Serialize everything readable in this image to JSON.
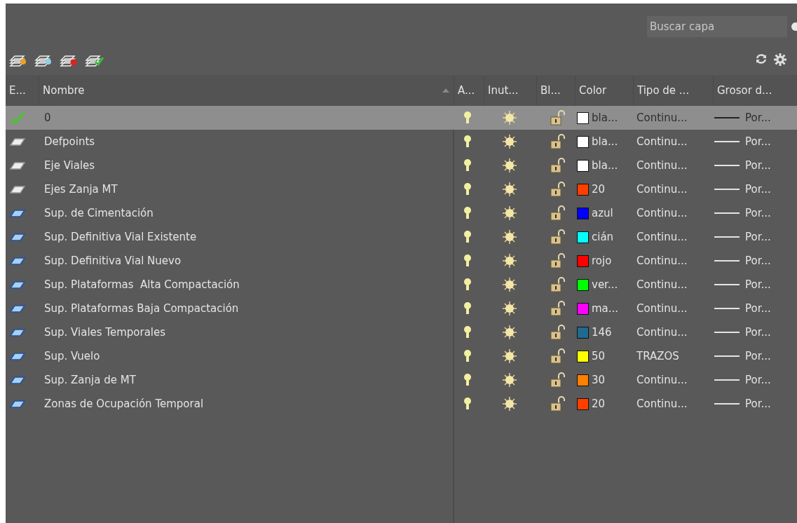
{
  "search": {
    "placeholder": "Buscar capa"
  },
  "table": {
    "columns": [
      {
        "label": "E...",
        "sorted": false
      },
      {
        "label": "Nombre",
        "sorted": true
      },
      {
        "label": "A...",
        "sorted": false
      },
      {
        "label": "Inut...",
        "sorted": false
      },
      {
        "label": "Bl...",
        "sorted": false
      },
      {
        "label": "Color",
        "sorted": false
      },
      {
        "label": "Tipo de ...",
        "sorted": false
      },
      {
        "label": "Grosor d...",
        "sorted": false
      }
    ],
    "rows": [
      {
        "current": true,
        "name": "0",
        "on": true,
        "frozen": false,
        "locked": false,
        "color": "#ffffff",
        "color_name": "bla...",
        "linetype": "Continu...",
        "lineweight": "Por...",
        "selected": true
      },
      {
        "current": false,
        "in_use": false,
        "name": "Defpoints",
        "on": true,
        "frozen": false,
        "locked": false,
        "color": "#ffffff",
        "color_name": "bla...",
        "linetype": "Continu...",
        "lineweight": "Por...",
        "selected": false
      },
      {
        "current": false,
        "in_use": false,
        "name": "Eje Viales",
        "on": true,
        "frozen": false,
        "locked": false,
        "color": "#ffffff",
        "color_name": "bla...",
        "linetype": "Continu...",
        "lineweight": "Por...",
        "selected": false
      },
      {
        "current": false,
        "in_use": false,
        "name": "Ejes Zanja MT",
        "on": true,
        "frozen": false,
        "locked": false,
        "color": "#ff3f00",
        "color_name": "20",
        "linetype": "Continu...",
        "lineweight": "Por...",
        "selected": false
      },
      {
        "current": false,
        "in_use": true,
        "name": "Sup. de Cimentación",
        "on": true,
        "frozen": false,
        "locked": false,
        "color": "#0000ff",
        "color_name": "azul",
        "linetype": "Continu...",
        "lineweight": "Por...",
        "selected": false
      },
      {
        "current": false,
        "in_use": true,
        "name": "Sup. Definitiva Vial Existente",
        "on": true,
        "frozen": false,
        "locked": false,
        "color": "#00ffff",
        "color_name": "cián",
        "linetype": "Continu...",
        "lineweight": "Por...",
        "selected": false
      },
      {
        "current": false,
        "in_use": true,
        "name": "Sup. Definitiva Vial Nuevo",
        "on": true,
        "frozen": false,
        "locked": false,
        "color": "#ff0000",
        "color_name": "rojo",
        "linetype": "Continu...",
        "lineweight": "Por...",
        "selected": false
      },
      {
        "current": false,
        "in_use": true,
        "name": "Sup. Plataformas  Alta Compactación",
        "on": true,
        "frozen": false,
        "locked": false,
        "color": "#00ff00",
        "color_name": "ver...",
        "linetype": "Continu...",
        "lineweight": "Por...",
        "selected": false
      },
      {
        "current": false,
        "in_use": true,
        "name": "Sup. Plataformas Baja Compactación",
        "on": true,
        "frozen": false,
        "locked": false,
        "color": "#ff00ff",
        "color_name": "ma...",
        "linetype": "Continu...",
        "lineweight": "Por...",
        "selected": false
      },
      {
        "current": false,
        "in_use": true,
        "name": "Sup. Viales Temporales",
        "on": true,
        "frozen": false,
        "locked": false,
        "color": "#1f6a8f",
        "color_name": "146",
        "linetype": "Continu...",
        "lineweight": "Por...",
        "selected": false
      },
      {
        "current": false,
        "in_use": true,
        "name": "Sup. Vuelo",
        "on": true,
        "frozen": false,
        "locked": false,
        "color": "#ffff00",
        "color_name": "50",
        "linetype": "TRAZOS",
        "lineweight": "Por...",
        "selected": false
      },
      {
        "current": false,
        "in_use": true,
        "name": "Sup. Zanja de MT",
        "on": true,
        "frozen": false,
        "locked": false,
        "color": "#ff7f00",
        "color_name": "30",
        "linetype": "Continu...",
        "lineweight": "Por...",
        "selected": false
      },
      {
        "current": false,
        "in_use": true,
        "name": "Zonas de Ocupación Temporal",
        "on": true,
        "frozen": false,
        "locked": false,
        "color": "#ff3f00",
        "color_name": "20",
        "linetype": "Continu...",
        "lineweight": "Por...",
        "selected": false
      }
    ]
  }
}
